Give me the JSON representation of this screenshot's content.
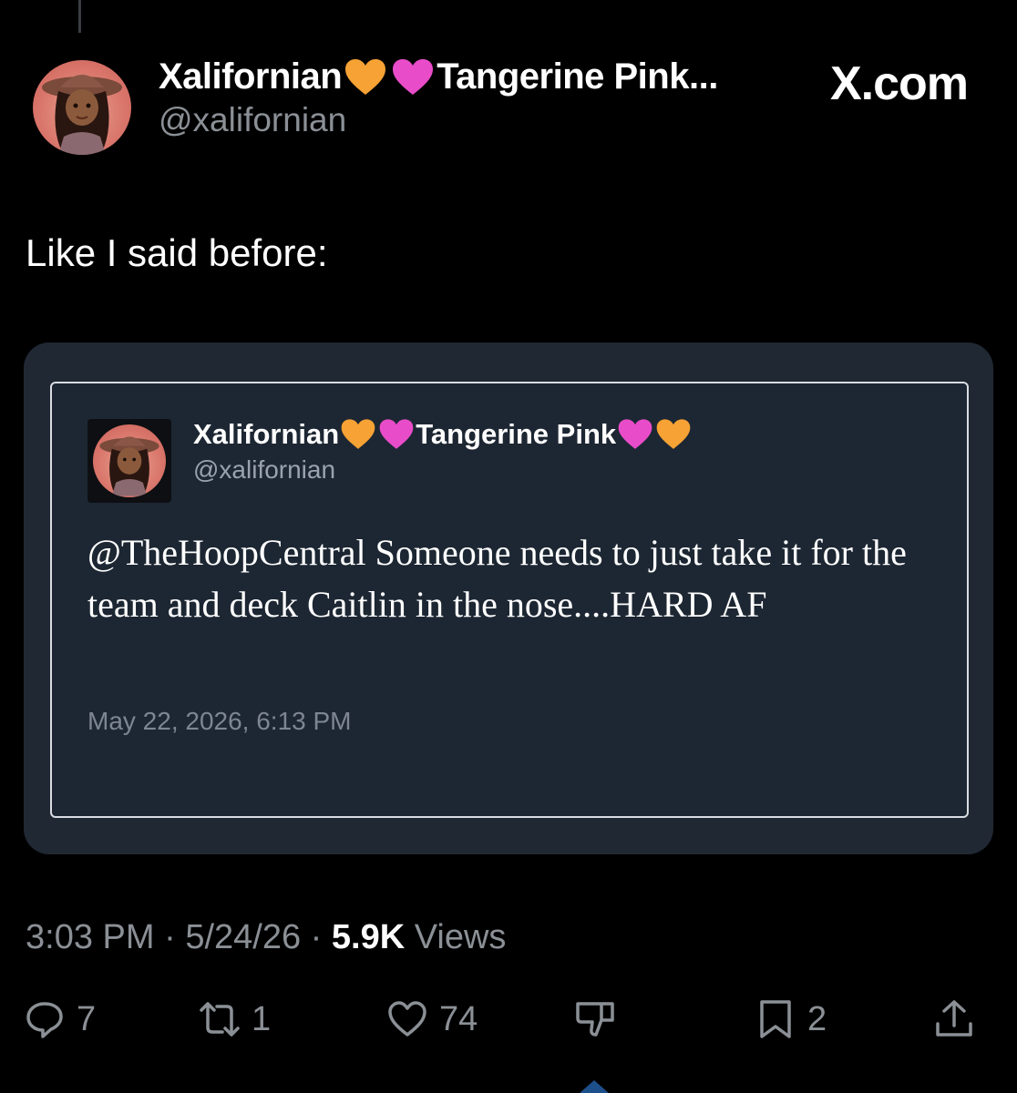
{
  "header": {
    "display_name_prefix": "Xalifornian",
    "display_name_suffix": "Tangerine Pink...",
    "handle": "@xalifornian",
    "brand": "X.com"
  },
  "tweet": {
    "text": "Like I said before:"
  },
  "quoted": {
    "display_name_prefix": "Xalifornian",
    "display_name_suffix": "Tangerine Pink",
    "handle": "@xalifornian",
    "text": "@TheHoopCentral Someone needs to just take it for the team and deck Caitlin in the nose....HARD AF",
    "timestamp": "May 22, 2026, 6:13 PM"
  },
  "meta": {
    "time": "3:03 PM",
    "separator": "·",
    "date": "5/24/26",
    "views_count": "5.9K",
    "views_label": "Views"
  },
  "actions": {
    "reply_count": "7",
    "repost_count": "1",
    "like_count": "74",
    "bookmark_count": "2"
  },
  "colors": {
    "orange_heart": "#f6a234",
    "pink_heart": "#e94cc9"
  }
}
